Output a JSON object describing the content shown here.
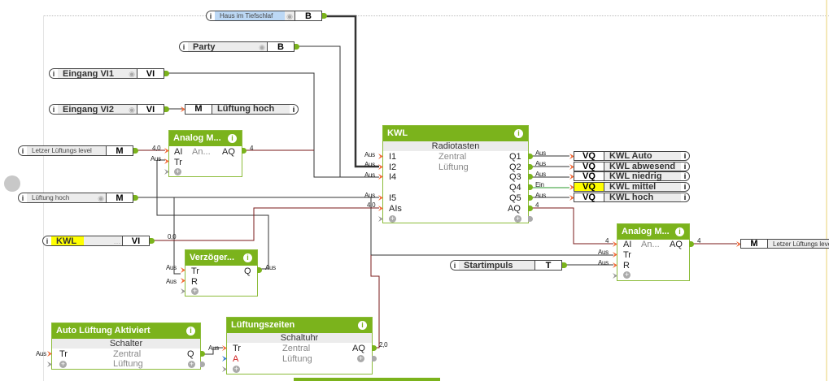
{
  "inputs": {
    "haus": {
      "label": "Haus im Tiefschlaf",
      "type": "B",
      "highlight": "#bcd8f5"
    },
    "party": {
      "label": "Party",
      "type": "B"
    },
    "vi1": {
      "label": "Eingang VI1",
      "type": "VI"
    },
    "vi2": {
      "label": "Eingang VI2",
      "type": "VI"
    },
    "letzer": {
      "label": "Letzer Lüftungs level",
      "type": "M"
    },
    "lhoch": {
      "label": "Lüftung hoch",
      "type": "M"
    },
    "kwl": {
      "label": "KWL",
      "type": "VI",
      "highlight": "#ffff00"
    },
    "start": {
      "label": "Startimpuls",
      "type": "T"
    }
  },
  "outputs": {
    "lueftung_hoch": {
      "type": "M",
      "label": "Lüftung hoch"
    },
    "vq": [
      {
        "type": "VQ",
        "label": "KWL Auto"
      },
      {
        "type": "VQ",
        "label": "KWL abwesend"
      },
      {
        "type": "VQ",
        "label": "KWL niedrig"
      },
      {
        "type": "VQ",
        "label": "KWL mittel",
        "active": true
      },
      {
        "type": "VQ",
        "label": "KWL hoch"
      }
    ],
    "letzer_out": {
      "type": "M",
      "label": "Letzer Lüftungs level"
    }
  },
  "blocks": {
    "analog1": {
      "title": "Analog M...",
      "in": [
        "AI",
        "Tr"
      ],
      "mid": "An...",
      "out": [
        "AQ"
      ]
    },
    "kwl": {
      "title": "KWL",
      "subtitle": "Radiotasten",
      "mid": [
        "Zentral",
        "Lüftung"
      ],
      "in": [
        "I1",
        "I2",
        "I4",
        "I5",
        "AIs"
      ],
      "out": [
        "Q1",
        "Q2",
        "Q3",
        "Q4",
        "Q5",
        "AQ"
      ]
    },
    "verz": {
      "title": "Verzöger...",
      "in": [
        "Tr",
        "R"
      ],
      "out": [
        "Q"
      ]
    },
    "analog2": {
      "title": "Analog M...",
      "in": [
        "AI",
        "Tr",
        "R"
      ],
      "mid": "An...",
      "out": [
        "AQ"
      ]
    },
    "auto": {
      "title": "Auto Lüftung Aktiviert",
      "subtitle": "Schalter",
      "mid": [
        "Zentral",
        "Lüftung"
      ],
      "in": [
        "Tr"
      ],
      "out": [
        "Q"
      ]
    },
    "zeiten": {
      "title": "Lüftungszeiten",
      "subtitle": "Schaltuhr",
      "mid": [
        "Zentral",
        "Lüftung"
      ],
      "in": [
        "Tr",
        "A"
      ],
      "out": [
        "AQ"
      ]
    }
  },
  "pin_values": {
    "aus": "Aus",
    "ein": "Ein",
    "v40": "4,0",
    "v4": "4",
    "v00": "0,0",
    "v20": "2,0"
  },
  "colors": {
    "block_header": "#7bb31c",
    "input_pin": "#f26b3a",
    "wire_analog": "#7a1a1a",
    "wire_on": "#2a9a2a"
  }
}
